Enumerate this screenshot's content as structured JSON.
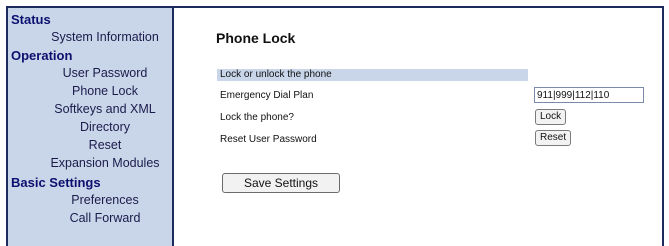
{
  "sidebar": {
    "sections": [
      {
        "title": "Status",
        "items": [
          "System Information"
        ]
      },
      {
        "title": "Operation",
        "items": [
          "User Password",
          "Phone Lock",
          "Softkeys and XML",
          "Directory",
          "Reset",
          "Expansion Modules"
        ]
      },
      {
        "title": "Basic Settings",
        "items": [
          "Preferences",
          "Call Forward"
        ]
      }
    ]
  },
  "main": {
    "title": "Phone Lock",
    "section_header": "Lock or unlock the phone",
    "emergency_label": "Emergency Dial Plan",
    "emergency_value": "911|999|112|110",
    "lock_label": "Lock the phone?",
    "lock_button": "Lock",
    "reset_label": "Reset User Password",
    "reset_button": "Reset",
    "save_button": "Save Settings"
  },
  "colors": {
    "sidebar_bg": "#c9d6ea",
    "frame_border": "#1c2a5e",
    "section_text": "#0d0f6e"
  }
}
